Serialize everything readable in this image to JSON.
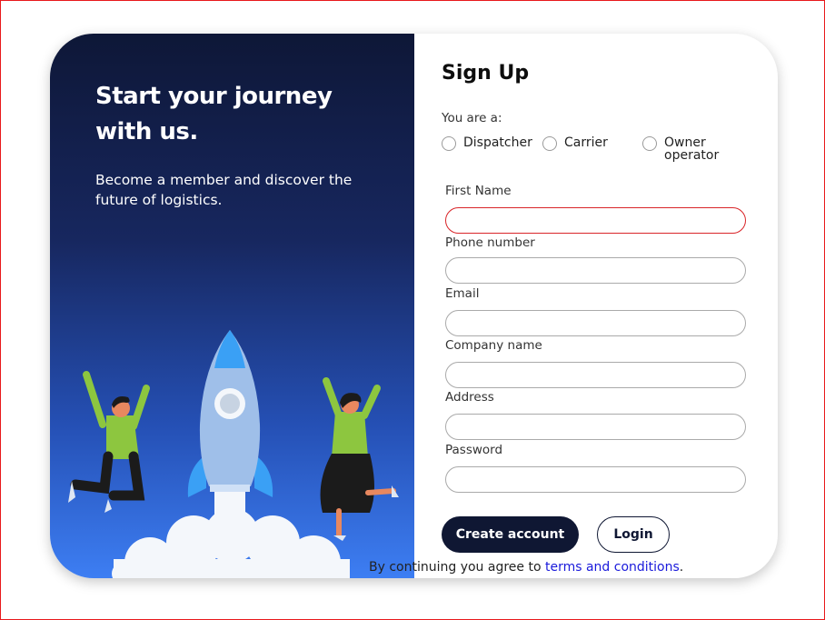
{
  "hero": {
    "title": "Start your journey with us.",
    "subtitle": "Become a member and discover the future of logistics."
  },
  "form": {
    "title": "Sign Up",
    "role_label": "You are a:",
    "roles": [
      {
        "label": "Dispatcher",
        "selected": false
      },
      {
        "label": "Carrier",
        "selected": false
      },
      {
        "label": "Owner operator",
        "selected": false
      }
    ],
    "fields": [
      {
        "label": "First  Name",
        "value": "",
        "state": "error"
      },
      {
        "label": "Phone number",
        "value": ""
      },
      {
        "label": "Email",
        "value": ""
      },
      {
        "label": "Company name",
        "value": ""
      },
      {
        "label": "Address",
        "value": ""
      },
      {
        "label": "Password",
        "value": ""
      }
    ],
    "create_label": "Create account",
    "login_label": "Login",
    "agree_text": "By continuing you agree to ",
    "terms_link": "terms and conditions",
    "agree_suffix": "."
  },
  "colors": {
    "navy": "#0f1733",
    "gradient_top": "#0e1737",
    "gradient_bottom": "#3d7ef3",
    "error_border": "#d9262a",
    "link": "#1a1adb",
    "figure_shirt": "#8dc63f"
  },
  "icons": [
    "rocket-illustration",
    "jumping-man-illustration",
    "jumping-woman-illustration",
    "cloud-illustration"
  ]
}
